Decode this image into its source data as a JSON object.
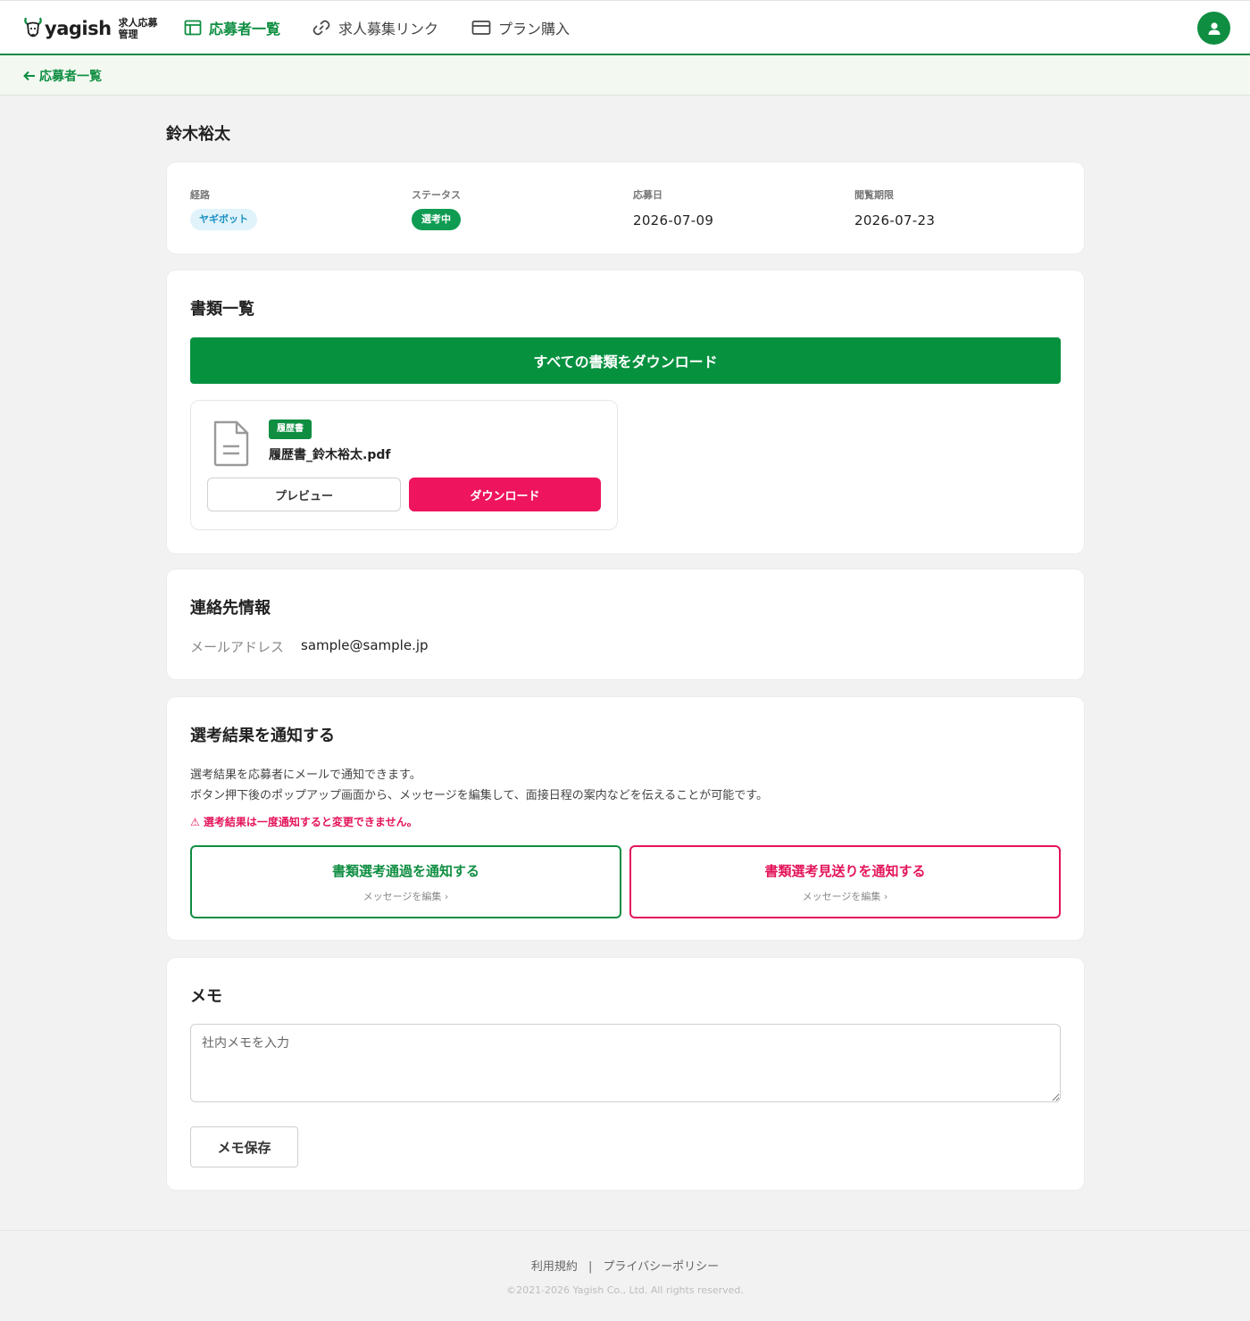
{
  "colors": {
    "brand_green": "#0f8e42",
    "accent_pink": "#ef145e",
    "background": "#f2f2f2"
  },
  "header": {
    "logo_text": "yagish",
    "logo_sub": "求人応募管理",
    "nav": [
      {
        "label": "応募者一覧",
        "icon": "layout-icon",
        "active": true
      },
      {
        "label": "求人募集リンク",
        "icon": "link-icon",
        "active": false
      },
      {
        "label": "プラン購入",
        "icon": "credit-card-icon",
        "active": false
      }
    ],
    "avatar_icon": "user-icon"
  },
  "breadcrumb": {
    "back_label": "応募者一覧",
    "icon": "arrow-left-icon"
  },
  "applicant": {
    "name": "鈴木裕太"
  },
  "summary": {
    "route": {
      "label": "経路",
      "value": "ヤギボット"
    },
    "status": {
      "label": "ステータス",
      "value": "選考中"
    },
    "applied": {
      "label": "応募日",
      "value": "2026-07-09"
    },
    "deadline": {
      "label": "閲覧期限",
      "value": "2026-07-23"
    }
  },
  "documents": {
    "title": "書類一覧",
    "download_all_label": "すべての書類をダウンロード",
    "items": [
      {
        "tag": "履歴書",
        "filename": "履歴書_鈴木裕太.pdf",
        "icon": "document-icon",
        "preview_label": "プレビュー",
        "download_label": "ダウンロード"
      }
    ]
  },
  "contact": {
    "title": "連絡先情報",
    "email_label": "メールアドレス",
    "email_value": "sample@sample.jp"
  },
  "notify": {
    "title": "選考結果を通知する",
    "desc_line1": "選考結果を応募者にメールで通知できます。",
    "desc_line2": "ボタン押下後のポップアップ画面から、メッセージを編集して、面接日程の案内などを伝えることが可能です。",
    "warning": "⚠ 選考結果は一度通知すると変更できません。",
    "pass_label": "書類選考通過を通知する",
    "pass_sub": "メッセージを編集 ›",
    "reject_label": "書類選考見送りを通知する",
    "reject_sub": "メッセージを編集 ›"
  },
  "memo": {
    "title": "メモ",
    "placeholder": "社内メモを入力",
    "save_label": "メモ保存"
  },
  "footer": {
    "terms": "利用規約",
    "separator": "|",
    "privacy": "プライバシーポリシー",
    "copyright": "©2021-2026 Yagish Co., Ltd. All rights reserved."
  }
}
